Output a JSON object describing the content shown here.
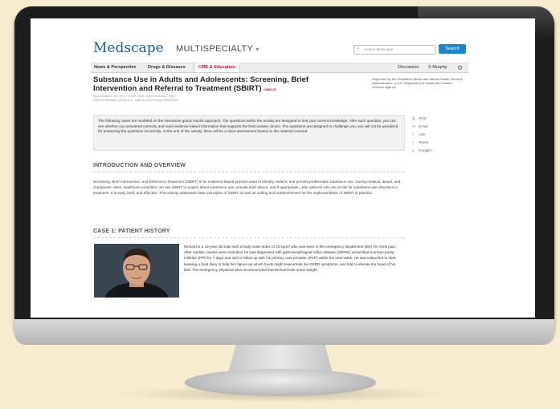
{
  "site": {
    "logo": "Medscape",
    "section": "MULTISPECIALTY",
    "section_caret": "▾",
    "search_placeholder": "Search Medscape",
    "search_label": "Search"
  },
  "nav": {
    "tabs": [
      "News & Perspective",
      "Drugs & Diseases",
      "CME & Education"
    ],
    "active_tab": "CME & Education",
    "discussion": "Discussion",
    "user": "S Murphy"
  },
  "article": {
    "title": "Substance Use in Adults and Adolescents: Screening, Brief Intervention and Referral to Treatment (SBIRT)",
    "badge": "CME/CE",
    "authors": "Mark Anzalone, MD; Kent Forman, MSW; Mark Kochhirschl, MSW",
    "released": "CME/CE Released: 08/18/2014 ; Valid for credit through 08/18/2015",
    "supporter": "Supported by the Substance Abuse and Mental Health Services Administration, a U.S. Department of Health and Human Services Agency.",
    "intro": "The following cases are modeled on the interactive grand rounds approach. The questions within the activity are designed to test your current knowledge. After each question, you can see whether you answered correctly and read evidence-based information that supports the best answer choice. The questions are designed to challenge you; you will not be penalized for answering the questions incorrectly. At the end of the activity, there will be a short assessment based on the material covered.",
    "section1_heading": "INTRODUCTION AND OVERVIEW",
    "section1_text": "Screening, Brief Intervention, and Referral to Treatment (SBIRT) is an evidence-based practice used to identify, reduce, and prevent problematic substance use. During medical, dental, and chiropractic visits, healthcare providers can use SBIRT to inquire about substance use, provide brief advice, and if appropriate, refer patients who are at risk for substance use disorders to treatment. It is easy, brief, and effective. This activity addresses basic principles of SBIRT as well as coding and reimbursement for the implementation of SBIRT in practice.",
    "section2_heading": "CASE 1: PATIENT HISTORY",
    "case_text": "Richard is a 43-year old man with a body mass index of 33 kg/m² who was seen in the emergency department (ED) for chest pain. After cardiac causes were excluded, he was diagnosed with gastroesophageal reflux disease (GERD), prescribed a proton-pump inhibitor (PPI) for 7 days and told to follow up with his primary care provider (PCP) within the next week. He was instructed to start keeping a food diary to help him figure out which foods might exacerbate his GERD symptoms, and told to elevate the head of his bed. The emergency physician also recommended that Richard lose some weight."
  },
  "share": [
    "Print",
    "Email",
    "Like",
    "Tweet",
    "Google+"
  ],
  "colors": {
    "brand": "#1c5c9e",
    "accent": "#c8112f",
    "search_button": "#1f87c9",
    "background": "#f6ecd0"
  }
}
